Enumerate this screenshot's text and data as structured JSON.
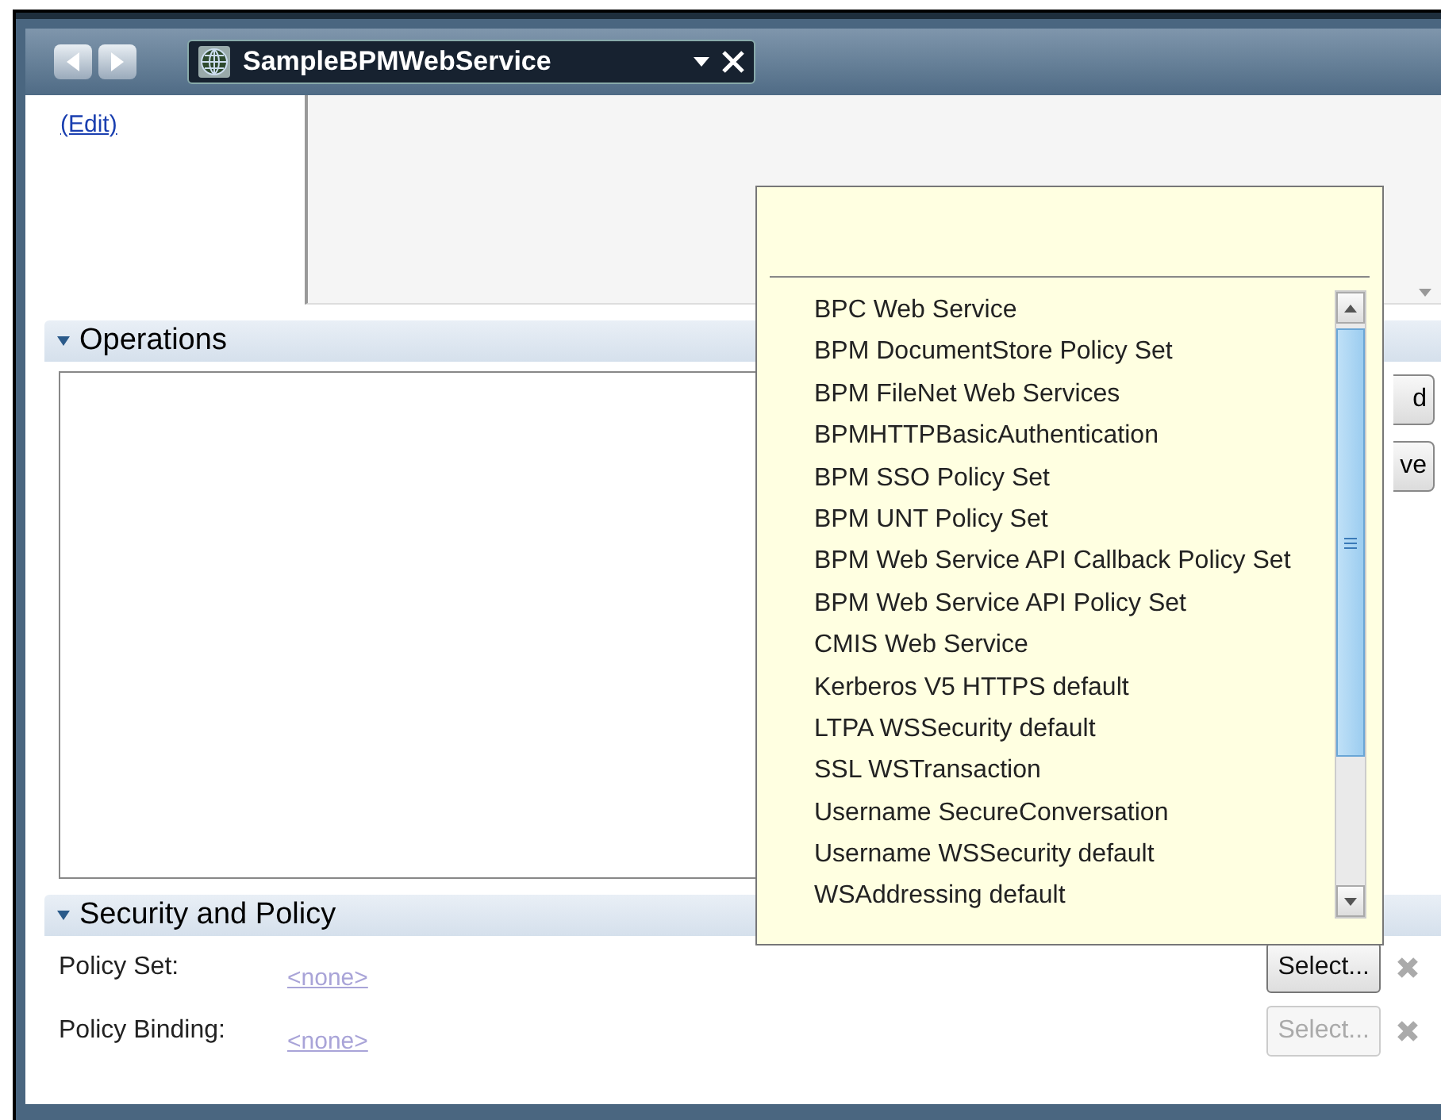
{
  "window": {
    "tab_title": "SampleBPMWebService"
  },
  "edit_link": "(Edit)",
  "operations": {
    "title": "Operations",
    "expanded": true,
    "buttons": [
      "d",
      "ve"
    ]
  },
  "popup": {
    "items": [
      {
        "label": "BPC Web Service"
      },
      {
        "label": "BPM DocumentStore Policy Set"
      },
      {
        "label": "BPM FileNet Web Services"
      },
      {
        "label": "BPMHTTPBasicAuthentication"
      },
      {
        "label": "BPM SSO Policy Set"
      },
      {
        "label": "BPM UNT Policy Set"
      },
      {
        "label": "BPM Web Service API Callback Policy Set"
      },
      {
        "label": "BPM Web Service API Policy Set"
      },
      {
        "label": "CMIS Web Service"
      },
      {
        "label": "Kerberos V5 HTTPS default"
      },
      {
        "label": "LTPA WSSecurity default"
      },
      {
        "label": "SSL WSTransaction"
      },
      {
        "label": "Username SecureConversation"
      },
      {
        "label": "Username WSSecurity default"
      },
      {
        "label": "WSAddressing default"
      }
    ]
  },
  "security": {
    "title": "Security and Policy",
    "expanded": true,
    "fields": [
      {
        "label": "Policy Set:",
        "value": "<none>",
        "button": {
          "label": "Select...",
          "disabled": false
        }
      },
      {
        "label": "Policy Binding:",
        "value": "<none>",
        "button": {
          "label": "Select...",
          "disabled": true
        }
      }
    ]
  }
}
